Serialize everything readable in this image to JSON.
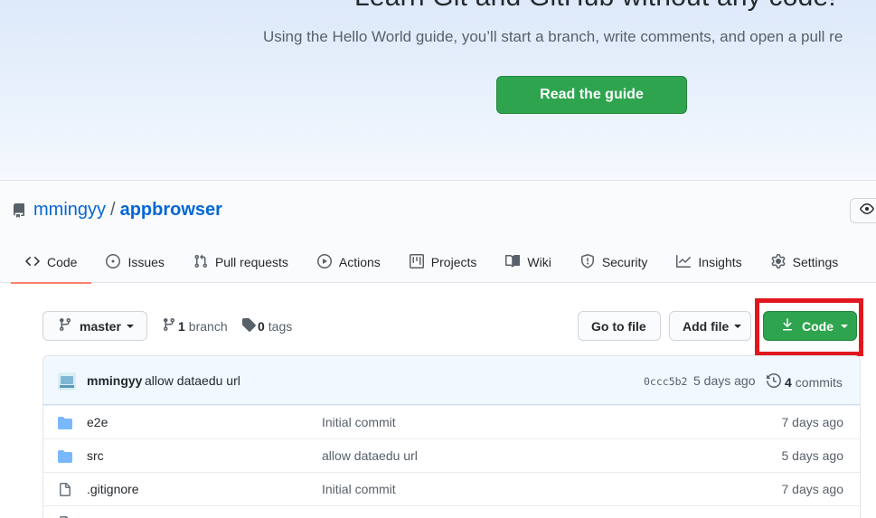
{
  "hero": {
    "title": "Learn Git and GitHub without any code!",
    "subtitle": "Using the Hello World guide, you’ll start a branch, write comments, and open a pull re",
    "button_label": "Read the guide"
  },
  "repo": {
    "owner": "mmingyy",
    "separator": "/",
    "name": "appbrowser"
  },
  "tabs": [
    {
      "label": "Code",
      "icon": "code-icon",
      "active": true
    },
    {
      "label": "Issues",
      "icon": "issue-icon"
    },
    {
      "label": "Pull requests",
      "icon": "pull-request-icon"
    },
    {
      "label": "Actions",
      "icon": "play-icon"
    },
    {
      "label": "Projects",
      "icon": "project-icon"
    },
    {
      "label": "Wiki",
      "icon": "book-icon"
    },
    {
      "label": "Security",
      "icon": "shield-icon"
    },
    {
      "label": "Insights",
      "icon": "graph-icon"
    },
    {
      "label": "Settings",
      "icon": "gear-icon"
    }
  ],
  "toolbar": {
    "branch_selector": "master",
    "branch_count": "1",
    "branch_label": "branch",
    "tag_count": "0",
    "tag_label": "tags",
    "goto_label": "Go to file",
    "addfile_label": "Add file",
    "code_label": "Code"
  },
  "latest_commit": {
    "author": "mmingyy",
    "message": "allow dataedu url",
    "sha": "0ccc5b2",
    "time": "5 days ago",
    "count": "4",
    "count_label": "commits"
  },
  "files": [
    {
      "name": "e2e",
      "type": "folder",
      "commit": "Initial commit",
      "age": "7 days ago"
    },
    {
      "name": "src",
      "type": "folder",
      "commit": "allow dataedu url",
      "age": "5 days ago"
    },
    {
      "name": ".gitignore",
      "type": "file",
      "commit": "Initial commit",
      "age": "7 days ago"
    }
  ],
  "colors": {
    "accent_green": "#2ea44f",
    "link_blue": "#0366d6",
    "active_tab_underline": "#f9826c",
    "highlight_red": "#e0181e"
  }
}
